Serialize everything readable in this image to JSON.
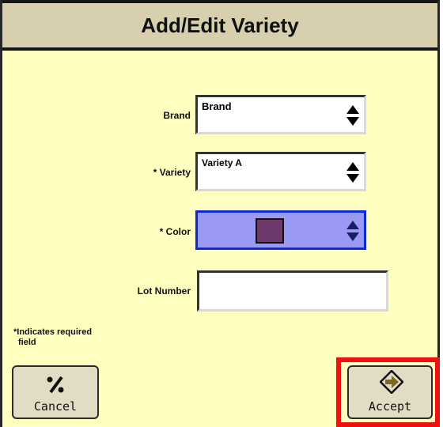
{
  "dialog": {
    "title": "Add/Edit Variety",
    "fields": {
      "brand": {
        "label": "Brand",
        "value": "Brand"
      },
      "variety": {
        "label": "* Variety",
        "value": "Variety A"
      },
      "color": {
        "label": "* Color",
        "swatch_color": "#6d3a6b"
      },
      "lot_number": {
        "label": "Lot Number",
        "value": ""
      }
    },
    "required_note_line1": "*Indicates required",
    "required_note_line2": "field",
    "buttons": {
      "cancel": {
        "label": "Cancel",
        "icon": "cancel-icon"
      },
      "accept": {
        "label": "Accept",
        "icon": "accept-arrow-icon"
      }
    }
  },
  "colors": {
    "panel_bg": "#ffffc0",
    "title_bg": "#d7cfae",
    "highlight": "#ef1111",
    "color_field": "#9a9af5"
  }
}
